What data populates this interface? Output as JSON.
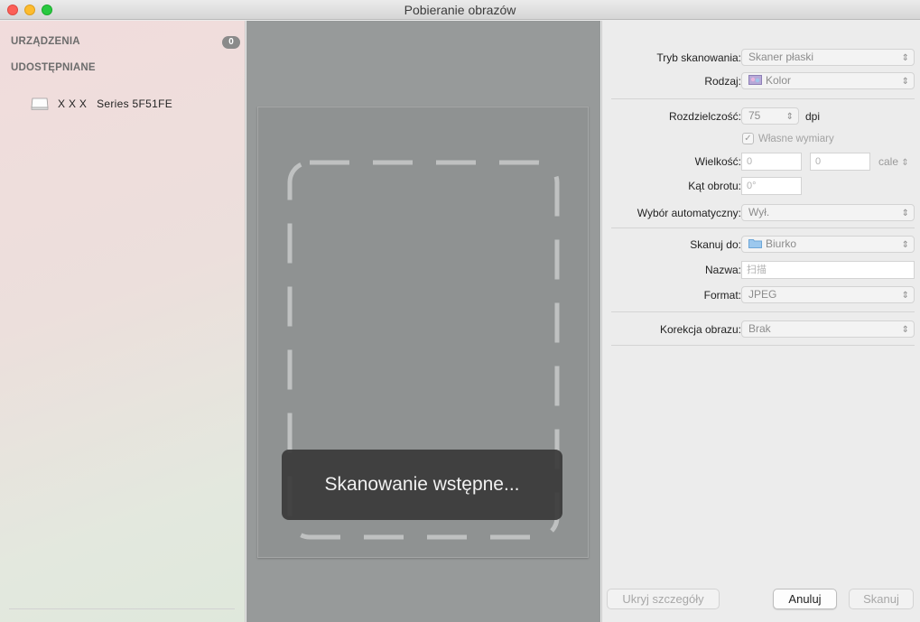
{
  "window": {
    "title": "Pobieranie obrazów"
  },
  "sidebar": {
    "devices_header": "URZĄDZENIA",
    "devices_count": "0",
    "shared_header": "UDOSTĘPNIANE",
    "items": [
      {
        "label": "X X X   Series 5F51FE",
        "icon": "scanner-icon"
      }
    ]
  },
  "preview": {
    "status": "Skanowanie wstępne..."
  },
  "settings": {
    "scan_mode": {
      "label": "Tryb skanowania:",
      "value": "Skaner płaski"
    },
    "kind": {
      "label": "Rodzaj:",
      "value": "Kolor"
    },
    "resolution": {
      "label": "Rozdzielczość:",
      "value": "75",
      "unit": "dpi"
    },
    "custom_size": {
      "label": "Własne wymiary",
      "checked": true
    },
    "size": {
      "label": "Wielkość:",
      "width": "0",
      "height": "0",
      "unit": "cale"
    },
    "rotation": {
      "label": "Kąt obrotu:",
      "value": "0°"
    },
    "auto_select": {
      "label": "Wybór automatyczny:",
      "value": "Wył."
    },
    "scan_to": {
      "label": "Skanuj do:",
      "value": "Biurko"
    },
    "name": {
      "label": "Nazwa:",
      "value": "扫描"
    },
    "format": {
      "label": "Format:",
      "value": "JPEG"
    },
    "correction": {
      "label": "Korekcja obrazu:",
      "value": "Brak"
    }
  },
  "buttons": {
    "hide_details": "Ukryj szczegóły",
    "cancel": "Anuluj",
    "scan": "Skanuj"
  }
}
